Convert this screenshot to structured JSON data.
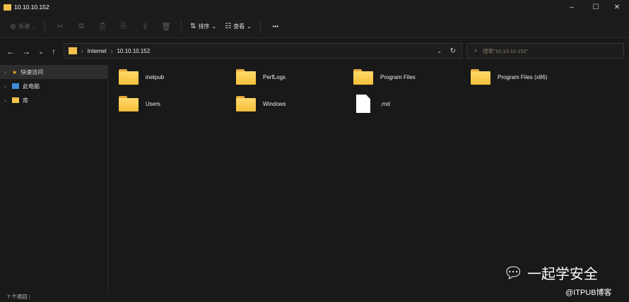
{
  "window": {
    "title": "10.10.10.152",
    "minimize": "–",
    "maximize": "☐",
    "close": "✕"
  },
  "toolbar": {
    "new_label": "新建",
    "sort_label": "排序",
    "view_label": "查看",
    "more": "•••"
  },
  "nav": {
    "breadcrumb": [
      "Internet",
      "10.10.10.152"
    ],
    "search_placeholder": "搜索\"10.10.10.152\""
  },
  "sidebar": {
    "items": [
      {
        "label": "快速访问"
      },
      {
        "label": "此电脑"
      },
      {
        "label": "库"
      }
    ]
  },
  "files": [
    {
      "name": "inetpub",
      "type": "folder"
    },
    {
      "name": "PerfLogs",
      "type": "folder"
    },
    {
      "name": "Program Files",
      "type": "folder"
    },
    {
      "name": "Program Files (x86)",
      "type": "folder"
    },
    {
      "name": "Users",
      "type": "folder"
    },
    {
      "name": "Windows",
      "type": "folder"
    },
    {
      "name": ".rnd",
      "type": "file"
    }
  ],
  "status": {
    "count": "7 个项目"
  },
  "watermark": {
    "title": "一起学安全",
    "sub": "@ITPUB博客"
  }
}
